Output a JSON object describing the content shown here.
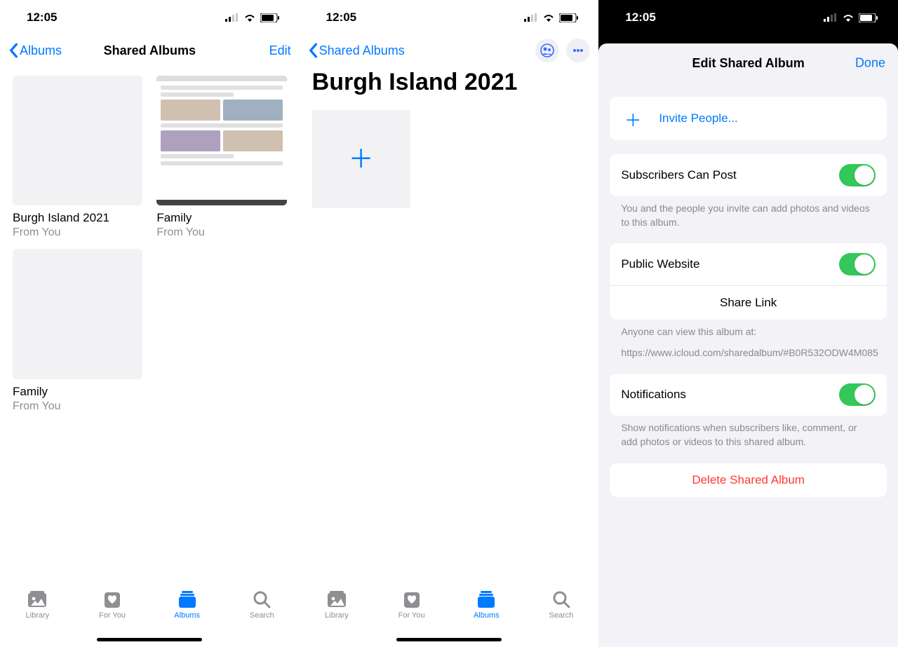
{
  "status": {
    "time": "12:05"
  },
  "screen1": {
    "back_label": "Albums",
    "title": "Shared Albums",
    "edit_label": "Edit",
    "albums": [
      {
        "title": "Burgh Island 2021",
        "subtitle": "From You"
      },
      {
        "title": "Family",
        "subtitle": "From You"
      },
      {
        "title": "Family",
        "subtitle": "From You"
      }
    ],
    "tabs": {
      "library": "Library",
      "for_you": "For You",
      "albums": "Albums",
      "search": "Search"
    }
  },
  "screen2": {
    "back_label": "Shared Albums",
    "title": "Burgh Island 2021",
    "tabs": {
      "library": "Library",
      "for_you": "For You",
      "albums": "Albums",
      "search": "Search"
    }
  },
  "screen3": {
    "title": "Edit Shared Album",
    "done_label": "Done",
    "invite_label": "Invite People...",
    "subscribers_label": "Subscribers Can Post",
    "subscribers_footer": "You and the people you invite can add photos and videos to this album.",
    "public_label": "Public Website",
    "share_link_label": "Share Link",
    "public_footer_line1": "Anyone can view this album at:",
    "public_footer_line2": "https://www.icloud.com/sharedalbum/#B0R532ODW4M085",
    "notifications_label": "Notifications",
    "notifications_footer": "Show notifications when subscribers like, comment, or add photos or videos to this shared album.",
    "delete_label": "Delete Shared Album"
  }
}
